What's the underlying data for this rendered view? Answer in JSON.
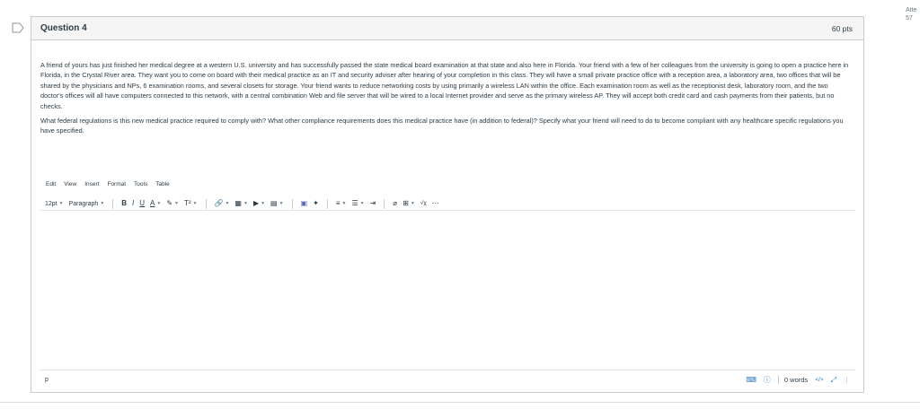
{
  "side_note": {
    "line1": "Atte",
    "line2": "57"
  },
  "question": {
    "title": "Question 4",
    "points": "60 pts",
    "paragraph1": "A friend of yours has just finished her medical degree at a western U.S. university and has successfully passed the state medical board examination at that state and also here in Florida. Your friend with a few of her colleagues from the university is going to open a practice here in Florida, in the Crystal River area. They want you to come on board with their medical practice as an IT and security adviser after hearing of your completion in this class. They will have a small private practice office with a reception area, a laboratory area, two offices that will be shared by the physicians and NPs, 6 examination rooms, and several closets for storage. Your friend wants to reduce networking costs by using primarily a wireless LAN within the office. Each examination room as well as the receptionist desk, laboratory room, and the two doctor's offices will all have computers connected to this network, with a central combination Web and file server that will be wired to a local Internet provider and serve as the primary wireless AP. They will accept both credit card and cash payments from their patients, but no checks.",
    "paragraph2": "What federal regulations is this new medical practice required to comply with? What other compliance requirements does this medical practice have (in addition to federal)? Specify what your friend will need to do to become compliant with any healthcare specific regulations you have specified."
  },
  "editor": {
    "menu": [
      "Edit",
      "View",
      "Insert",
      "Format",
      "Tools",
      "Table"
    ],
    "font_size": "12pt",
    "block_format": "Paragraph",
    "toolbar_icons": {
      "bold": "B",
      "italic": "I",
      "underline": "U",
      "text_color": "A",
      "highlight": "✎",
      "superscript": "T²",
      "link": "🔗",
      "image": "▦",
      "media": "▶",
      "document": "▤",
      "apps": "▣",
      "embed": "✦",
      "align": "≡",
      "list": "☰",
      "indent": "⇥",
      "clear_format": "⌀",
      "table": "⊞",
      "math": "√χ",
      "more": "⋯"
    },
    "status_path": "p",
    "word_count": "0 words",
    "html_toggle": "</>",
    "accent": "#2b7abc"
  }
}
